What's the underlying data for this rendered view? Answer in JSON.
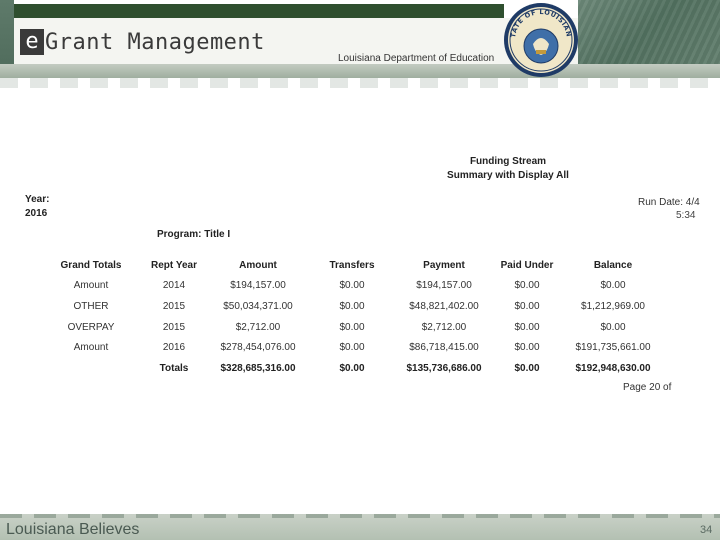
{
  "header": {
    "logo_e": "e",
    "logo_rest": "Grant Management",
    "department": "Louisiana Department of Education",
    "seal_icon": "state-of-louisiana-seal-icon",
    "seal_text": "STATE OF LOUISIANA",
    "colors": {
      "dark_green": "#2f4f2f",
      "chalkboard": "#5e7a6a"
    }
  },
  "report": {
    "title_line1": "Funding Stream",
    "title_line2": "Summary with Display All",
    "year_label": "Year:",
    "year_value": "2016",
    "run_date": "Run Date: 4/4",
    "run_time": "5:34",
    "program": "Program: Title I",
    "columns": [
      "Grand Totals",
      "Rept Year",
      "Amount",
      "Transfers",
      "Payment",
      "Paid Under",
      "Balance"
    ],
    "rows": [
      [
        "Amount",
        "2014",
        "$194,157.00",
        "$0.00",
        "$194,157.00",
        "$0.00",
        "$0.00"
      ],
      [
        "OTHER",
        "2015",
        "$50,034,371.00",
        "$0.00",
        "$48,821,402.00",
        "$0.00",
        "$1,212,969.00"
      ],
      [
        "OVERPAY",
        "2015",
        "$2,712.00",
        "$0.00",
        "$2,712.00",
        "$0.00",
        "$0.00"
      ],
      [
        "Amount",
        "2016",
        "$278,454,076.00",
        "$0.00",
        "$86,718,415.00",
        "$0.00",
        "$191,735,661.00"
      ]
    ],
    "totals": [
      "",
      "Totals",
      "$328,685,316.00",
      "$0.00",
      "$135,736,686.00",
      "$0.00",
      "$192,948,630.00"
    ],
    "page": "Page 20 of"
  },
  "footer": {
    "left": "Louisiana Believes",
    "slide_number": "34"
  }
}
